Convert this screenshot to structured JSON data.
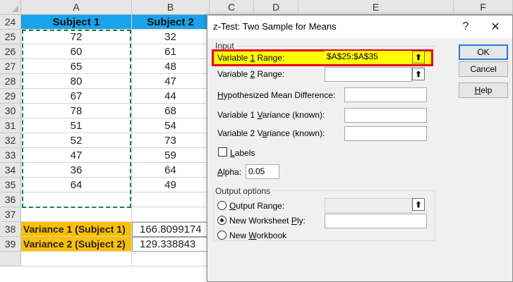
{
  "columns": [
    "A",
    "B",
    "C",
    "D",
    "E",
    "F"
  ],
  "rows": [
    "24",
    "25",
    "26",
    "27",
    "28",
    "29",
    "30",
    "31",
    "32",
    "33",
    "34",
    "35",
    "36",
    "37",
    "38",
    "39",
    ""
  ],
  "table": {
    "headers": [
      "Subject 1",
      "Subject 2"
    ],
    "subject1": [
      "72",
      "60",
      "65",
      "80",
      "67",
      "78",
      "51",
      "52",
      "47",
      "36",
      "64"
    ],
    "subject2": [
      "32",
      "61",
      "48",
      "47",
      "44",
      "68",
      "54",
      "73",
      "59",
      "64",
      "49"
    ]
  },
  "variance": [
    {
      "label": "Variance 1 (Subject 1)",
      "value": "166.8099174"
    },
    {
      "label": "Variance 2 (Subject 2)",
      "value": "129.338843"
    }
  ],
  "dialog": {
    "title": "z-Test: Two Sample for Means",
    "help_glyph": "?",
    "close_glyph": "✕",
    "input_group": "Input",
    "var1_label": "Variable 1 Range:",
    "var1_value": "$A$25:$A$35",
    "var2_label": "Variable 2 Range:",
    "var2_value": "",
    "hyp_label": "Hypothesized Mean Difference:",
    "var1_known_label": "Variable 1 Variance (known):",
    "var2_known_label": "Variable 2 Variance (known):",
    "labels_label": "Labels",
    "alpha_label": "Alpha:",
    "alpha_value": "0.05",
    "output_group": "Output options",
    "output_range_label": "Output Range:",
    "new_ply_label": "New Worksheet Ply:",
    "new_workbook_label": "New Workbook",
    "ok_label": "OK",
    "cancel_label": "Cancel",
    "help_label": "Help",
    "ref_glyph": "⬆"
  }
}
